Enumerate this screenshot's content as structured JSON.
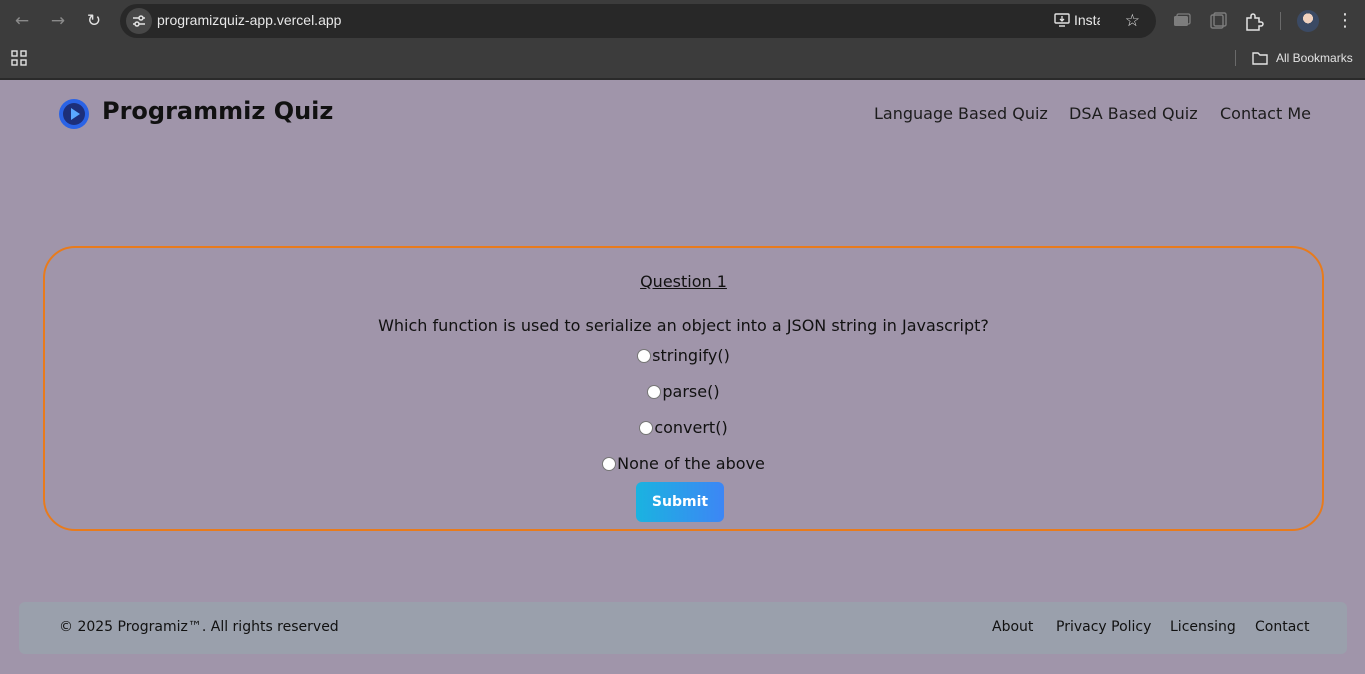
{
  "browser": {
    "url": "programizquiz-app.vercel.app",
    "install_label": "Install",
    "bookmarks_label": "All Bookmarks"
  },
  "header": {
    "brand": "Programmiz Quiz",
    "nav": [
      "Language Based Quiz",
      "DSA Based Quiz",
      "Contact Me"
    ]
  },
  "quiz": {
    "question_number": "Question 1",
    "question_text": "Which function is used to serialize an object into a JSON string in Javascript?",
    "options": [
      "stringify()",
      "parse()",
      "convert()",
      "None of the above"
    ],
    "submit_label": "Submit"
  },
  "footer": {
    "copyright": "© 2025 Programiz™. All rights reserved",
    "links": [
      "About",
      "Privacy Policy",
      "Licensing",
      "Contact"
    ]
  },
  "colors": {
    "page_bg": "#a095aa",
    "card_border": "#e87b1c",
    "button_gradient_start": "#1ab3e0",
    "button_gradient_end": "#3d86f5",
    "footer_bg": "#9aa0ac"
  },
  "icons": [
    "back-arrow-icon",
    "forward-arrow-icon",
    "reload-icon",
    "site-settings-icon",
    "install-icon",
    "star-icon",
    "media-icon",
    "tab-search-icon",
    "extensions-icon",
    "avatar",
    "kebab-menu-icon",
    "apps-grid-icon",
    "folder-icon",
    "play-logo-icon"
  ]
}
